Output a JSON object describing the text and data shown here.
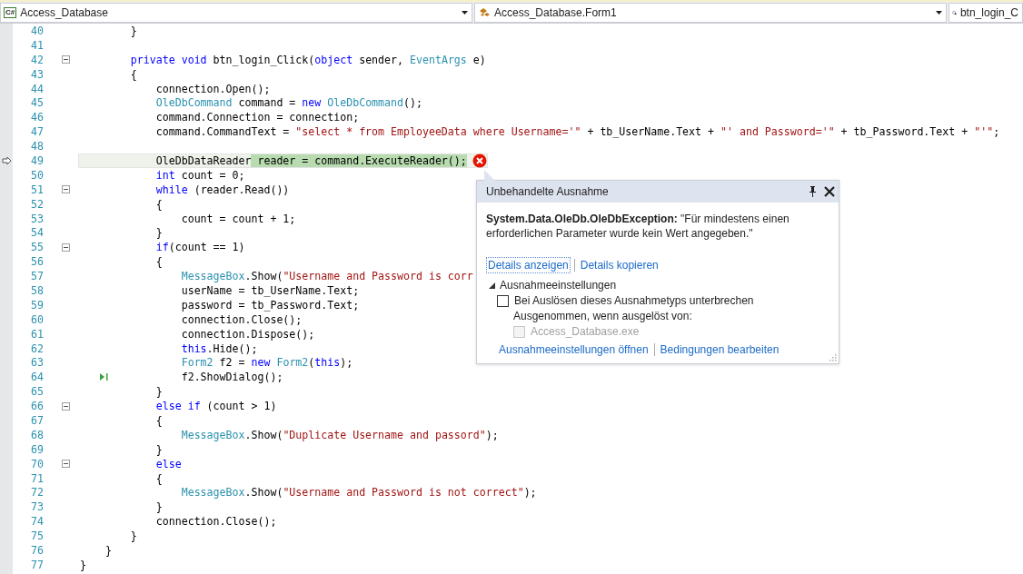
{
  "navigation_bar": {
    "dropdowns": [
      {
        "icon_label": "C#",
        "kind": "project",
        "text": "Access_Database"
      },
      {
        "kind": "class",
        "text": "Access_Database.Form1"
      },
      {
        "kind": "member",
        "text": "btn_login_C"
      }
    ]
  },
  "editor": {
    "lines": [
      {
        "number": "40",
        "tokens": [
          {
            "text": "        }",
            "kind": "plain"
          }
        ]
      },
      {
        "number": "41"
      },
      {
        "number": "42",
        "foldable": true,
        "tokens": [
          {
            "text": "        private",
            "kind": "keyword"
          },
          {
            "text": " void",
            "kind": "keyword"
          },
          {
            "text": " btn_login_Click(",
            "kind": "plain"
          },
          {
            "text": "object",
            "kind": "keyword"
          },
          {
            "text": " sender, ",
            "kind": "plain"
          },
          {
            "text": "EventArgs",
            "kind": "type"
          },
          {
            "text": " e)",
            "kind": "plain"
          }
        ]
      },
      {
        "number": "43",
        "tokens": [
          {
            "text": "        {",
            "kind": "plain"
          }
        ]
      },
      {
        "number": "44",
        "tokens": [
          {
            "text": "            connection.Open();",
            "kind": "plain"
          }
        ]
      },
      {
        "number": "45",
        "tokens": [
          {
            "text": "            OleDbCommand",
            "kind": "type"
          },
          {
            "text": " command = ",
            "kind": "plain"
          },
          {
            "text": "new",
            "kind": "keyword"
          },
          {
            "text": " OleDbCommand",
            "kind": "type"
          },
          {
            "text": "();",
            "kind": "plain"
          }
        ]
      },
      {
        "number": "46",
        "tokens": [
          {
            "text": "            command.Connection = connection;",
            "kind": "plain"
          }
        ]
      },
      {
        "number": "47",
        "tokens": [
          {
            "text": "            command.CommandText = ",
            "kind": "plain"
          },
          {
            "text": "\"select * from EmployeeData where Username='\"",
            "kind": "string"
          },
          {
            "text": " + tb_UserName.Text + ",
            "kind": "plain"
          },
          {
            "text": "\"' and Password='\"",
            "kind": "string"
          },
          {
            "text": " + tb_Password.Text + ",
            "kind": "plain"
          },
          {
            "text": "\"'\"",
            "kind": "string"
          },
          {
            "text": ";",
            "kind": "plain"
          }
        ]
      },
      {
        "number": "48"
      },
      {
        "number": "49",
        "current": true,
        "error": true,
        "tokens": [
          {
            "text": "            OleDbDataReader",
            "kind": "plain"
          },
          {
            "text": " reader = command.ExecuteReader();",
            "kind": "plain",
            "highlighted": true
          }
        ]
      },
      {
        "number": "50",
        "tokens": [
          {
            "text": "            int",
            "kind": "keyword"
          },
          {
            "text": " count = 0;",
            "kind": "plain"
          }
        ]
      },
      {
        "number": "51",
        "foldable": true,
        "tokens": [
          {
            "text": "            while",
            "kind": "keyword"
          },
          {
            "text": " (reader.Read())",
            "kind": "plain"
          }
        ]
      },
      {
        "number": "52",
        "tokens": [
          {
            "text": "            {",
            "kind": "plain"
          }
        ]
      },
      {
        "number": "53",
        "tokens": [
          {
            "text": "                count = count + 1;",
            "kind": "plain"
          }
        ]
      },
      {
        "number": "54",
        "tokens": [
          {
            "text": "            }",
            "kind": "plain"
          }
        ]
      },
      {
        "number": "55",
        "foldable": true,
        "tokens": [
          {
            "text": "            if",
            "kind": "keyword"
          },
          {
            "text": "(count == 1)",
            "kind": "plain"
          }
        ]
      },
      {
        "number": "56",
        "tokens": [
          {
            "text": "            {",
            "kind": "plain"
          }
        ]
      },
      {
        "number": "57",
        "tokens": [
          {
            "text": "                MessageBox",
            "kind": "type"
          },
          {
            "text": ".Show(",
            "kind": "plain"
          },
          {
            "text": "\"Username and Password is corr",
            "kind": "string"
          }
        ]
      },
      {
        "number": "58",
        "tokens": [
          {
            "text": "                userName = tb_UserName.Text;",
            "kind": "plain"
          }
        ]
      },
      {
        "number": "59",
        "tokens": [
          {
            "text": "                password = tb_Password.Text;",
            "kind": "plain"
          }
        ]
      },
      {
        "number": "60",
        "tokens": [
          {
            "text": "                connection.Close();",
            "kind": "plain"
          }
        ]
      },
      {
        "number": "61",
        "tokens": [
          {
            "text": "                connection.Dispose();",
            "kind": "plain"
          }
        ]
      },
      {
        "number": "62",
        "tokens": [
          {
            "text": "                this",
            "kind": "keyword"
          },
          {
            "text": ".Hide();",
            "kind": "plain"
          }
        ]
      },
      {
        "number": "63",
        "tokens": [
          {
            "text": "                Form2",
            "kind": "type"
          },
          {
            "text": " f2 = ",
            "kind": "plain"
          },
          {
            "text": "new",
            "kind": "keyword"
          },
          {
            "text": " Form2",
            "kind": "type"
          },
          {
            "text": "(",
            "kind": "plain"
          },
          {
            "text": "this",
            "kind": "keyword"
          },
          {
            "text": ");",
            "kind": "plain"
          }
        ]
      },
      {
        "number": "64",
        "run_marker": true,
        "tokens": [
          {
            "text": "                f2.ShowDialog();",
            "kind": "plain"
          }
        ]
      },
      {
        "number": "65",
        "tokens": [
          {
            "text": "            }",
            "kind": "plain"
          }
        ]
      },
      {
        "number": "66",
        "foldable": true,
        "tokens": [
          {
            "text": "            else",
            "kind": "keyword"
          },
          {
            "text": " if",
            "kind": "keyword"
          },
          {
            "text": " (count > 1)",
            "kind": "plain"
          }
        ]
      },
      {
        "number": "67",
        "tokens": [
          {
            "text": "            {",
            "kind": "plain"
          }
        ]
      },
      {
        "number": "68",
        "tokens": [
          {
            "text": "                MessageBox",
            "kind": "type"
          },
          {
            "text": ".Show(",
            "kind": "plain"
          },
          {
            "text": "\"Duplicate Username and passord\"",
            "kind": "string"
          },
          {
            "text": ");",
            "kind": "plain"
          }
        ]
      },
      {
        "number": "69",
        "tokens": [
          {
            "text": "            }",
            "kind": "plain"
          }
        ]
      },
      {
        "number": "70",
        "foldable": true,
        "tokens": [
          {
            "text": "            else",
            "kind": "keyword"
          }
        ]
      },
      {
        "number": "71",
        "tokens": [
          {
            "text": "            {",
            "kind": "plain"
          }
        ]
      },
      {
        "number": "72",
        "tokens": [
          {
            "text": "                MessageBox",
            "kind": "type"
          },
          {
            "text": ".Show(",
            "kind": "plain"
          },
          {
            "text": "\"Username and Password is not correct\"",
            "kind": "string"
          },
          {
            "text": ");",
            "kind": "plain"
          }
        ]
      },
      {
        "number": "73",
        "tokens": [
          {
            "text": "            }",
            "kind": "plain"
          }
        ]
      },
      {
        "number": "74",
        "tokens": [
          {
            "text": "            connection.Close();",
            "kind": "plain"
          }
        ]
      },
      {
        "number": "75",
        "tokens": [
          {
            "text": "        }",
            "kind": "plain"
          }
        ]
      },
      {
        "number": "76",
        "tokens": [
          {
            "text": "    }",
            "kind": "plain"
          }
        ]
      },
      {
        "number": "77",
        "tokens": [
          {
            "text": "}",
            "kind": "plain"
          }
        ]
      }
    ]
  },
  "exception_popup": {
    "title": "Unbehandelte Ausnahme",
    "message": "**System.Data.OleDb.OleDbException:** \"Für mindestens einen erforderlichen Parameter wurde kein Wert angegeben.\"",
    "links": [
      {
        "text": "Details anzeigen",
        "focused": true
      },
      {
        "text": "Details kopieren",
        "focused": false
      }
    ],
    "settings": {
      "title": "Ausnahmeeinstellungen",
      "expanded": true,
      "break_option": {
        "label": "Bei Auslösen dieses Ausnahmetyps unterbrechen",
        "checked": false
      },
      "except_label": "Ausgenommen, wenn ausgelöst von:",
      "modules": [
        {
          "label": "Access_Database.exe",
          "checked": false,
          "disabled": true
        }
      ]
    },
    "footer_links": [
      {
        "text": "Ausnahmeeinstellungen öffnen"
      },
      {
        "text": "Bedingungen bearbeiten"
      }
    ]
  }
}
